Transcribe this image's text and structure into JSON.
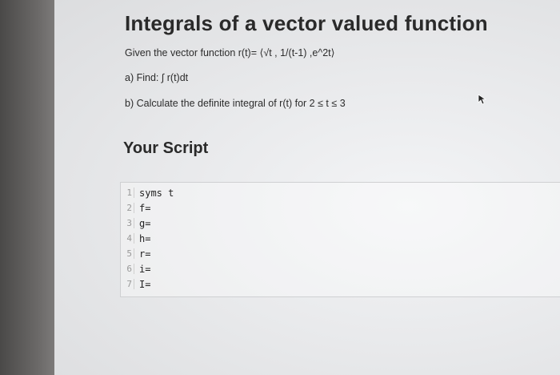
{
  "header": {
    "title": "Integrals of a vector valued function"
  },
  "problem": {
    "given": "Given the vector function r(t)= ⟨√t , 1/(t-1) ,e^2t⟩",
    "part_a": "a) Find: ∫ r(t)dt",
    "part_b": "b) Calculate the definite integral of r(t) for 2 ≤ t ≤ 3"
  },
  "script": {
    "title": "Your Script",
    "lines": [
      {
        "num": "1",
        "code": "syms t"
      },
      {
        "num": "2",
        "code": "f="
      },
      {
        "num": "3",
        "code": "g="
      },
      {
        "num": "4",
        "code": "h="
      },
      {
        "num": "5",
        "code": "r="
      },
      {
        "num": "6",
        "code": "i="
      },
      {
        "num": "7",
        "code": "I="
      }
    ]
  }
}
